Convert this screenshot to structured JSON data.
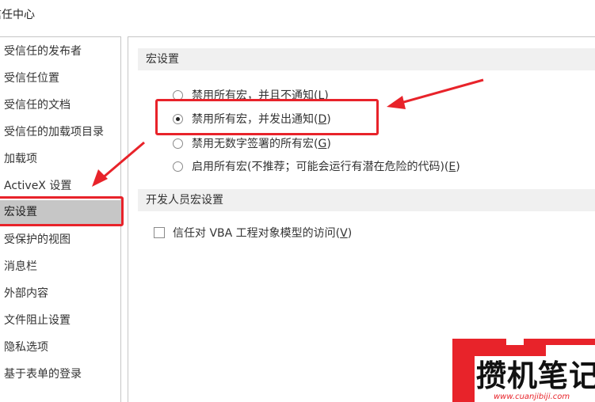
{
  "window": {
    "title": "信任中心"
  },
  "sidebar": {
    "items": [
      {
        "label": "受信任的发布者",
        "selected": false
      },
      {
        "label": "受信任位置",
        "selected": false
      },
      {
        "label": "受信任的文档",
        "selected": false
      },
      {
        "label": "受信任的加载项目录",
        "selected": false
      },
      {
        "label": "加载项",
        "selected": false
      },
      {
        "label": "ActiveX 设置",
        "selected": false
      },
      {
        "label": "宏设置",
        "selected": true
      },
      {
        "label": "受保护的视图",
        "selected": false
      },
      {
        "label": "消息栏",
        "selected": false
      },
      {
        "label": "外部内容",
        "selected": false
      },
      {
        "label": "文件阻止设置",
        "selected": false
      },
      {
        "label": "隐私选项",
        "selected": false
      },
      {
        "label": "基于表单的登录",
        "selected": false
      }
    ]
  },
  "macro_settings": {
    "header": "宏设置",
    "options": [
      {
        "label": "禁用所有宏，并且不通知(",
        "key": "L",
        "suffix": ")",
        "checked": false
      },
      {
        "label": "禁用所有宏，并发出通知(",
        "key": "D",
        "suffix": ")",
        "checked": true
      },
      {
        "label": "禁用无数字签署的所有宏(",
        "key": "G",
        "suffix": ")",
        "checked": false
      },
      {
        "label": "启用所有宏(不推荐；可能会运行有潜在危险的代码)(",
        "key": "E",
        "suffix": ")",
        "checked": false
      }
    ]
  },
  "developer_settings": {
    "header": "开发人员宏设置",
    "vba_access": {
      "label": "信任对 VBA 工程对象模型的访问(",
      "key": "V",
      "suffix": ")",
      "checked": false
    }
  },
  "watermark": {
    "brand": "攒机笔记",
    "url": "www.cuanjibiji.com"
  },
  "colors": {
    "annotation_red": "#e8232a",
    "selected_bg": "#c6c6c6",
    "header_bg": "#f0f0f0"
  }
}
